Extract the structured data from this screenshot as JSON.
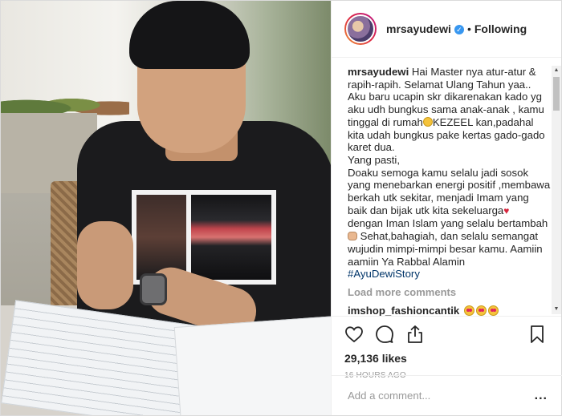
{
  "header": {
    "username": "mrsayudewi",
    "verified_mark": "✓",
    "separator": "•",
    "follow_status": "Following"
  },
  "caption": {
    "username": "mrsayudewi",
    "lines": [
      "Hai Master nya atur-atur &",
      "rapih-rapih. Selamat Ulang Tahun yaa..",
      "Aku baru ucapin skr dikarenakan kado yg",
      "aku udh bungkus sama anak-anak , kamu",
      "tinggal di rumah",
      "KEZEEL kan,padahal",
      "kita udah bungkus pake kertas gado-gado",
      "karet dua.",
      "Yang pasti,",
      "Doaku semoga kamu selalu jadi sosok",
      "yang menebarkan energi positif ,membawa",
      "berkah utk sekitar, menjadi Imam yang",
      "baik dan bijak utk kita sekeluarga",
      "dengan Iman Islam yang selalu bertambah",
      "Sehat,bahagiah, dan selalu semangat",
      "wujudin mimpi-mimpi besar kamu. Aamiin",
      "aamiin Ya Rabbal Alamin",
      "#AyuDewiStory"
    ]
  },
  "load_more": "Load more comments",
  "comment": {
    "username": "imshop_fashioncantik"
  },
  "stats": {
    "likes": "29,136 likes",
    "time_ago": "16 HOURS AGO"
  },
  "add_comment": {
    "placeholder": "Add a comment...",
    "more": "..."
  },
  "icons": {
    "like": "heart-icon",
    "comment": "comment-bubble-icon",
    "share": "share-icon",
    "save": "bookmark-icon"
  },
  "colors": {
    "verified": "#3897f0",
    "hashtag": "#003569",
    "muted": "#999999",
    "text": "#262626"
  }
}
